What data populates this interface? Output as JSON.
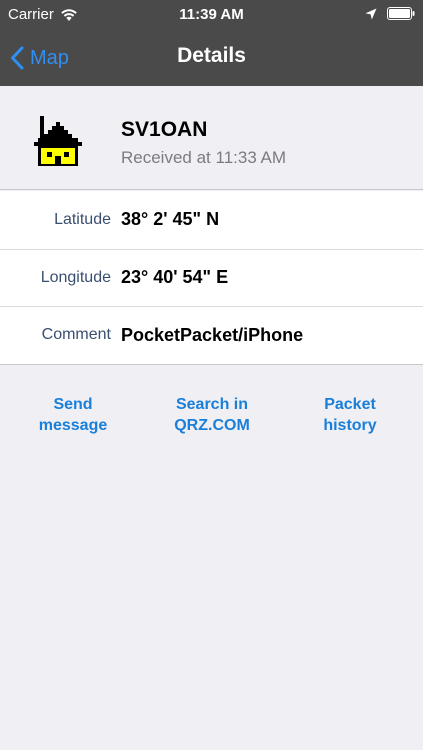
{
  "status_bar": {
    "carrier": "Carrier",
    "time": "11:39 AM",
    "icons": [
      "wifi-icon",
      "location-arrow-icon",
      "battery-icon"
    ]
  },
  "nav": {
    "back_label": "Map",
    "title": "Details"
  },
  "station": {
    "icon": "house-symbol-icon",
    "callsign": "SV1OAN",
    "received": "Received at 11:33 AM"
  },
  "details": [
    {
      "label": "Latitude",
      "value": "38° 2' 45\" N"
    },
    {
      "label": "Longitude",
      "value": "23° 40' 54\" E"
    },
    {
      "label": "Comment",
      "value": "PocketPacket/iPhone"
    }
  ],
  "actions": [
    {
      "line1": "Send",
      "line2": "message"
    },
    {
      "line1": "Search in",
      "line2": "QRZ.COM"
    },
    {
      "line1": "Packet",
      "line2": "history"
    }
  ],
  "colors": {
    "bar_bg": "#4a4a4a",
    "accent": "#2f8ff3",
    "link": "#1a7fd9",
    "label": "#3a4f70",
    "background": "#efeff4"
  }
}
